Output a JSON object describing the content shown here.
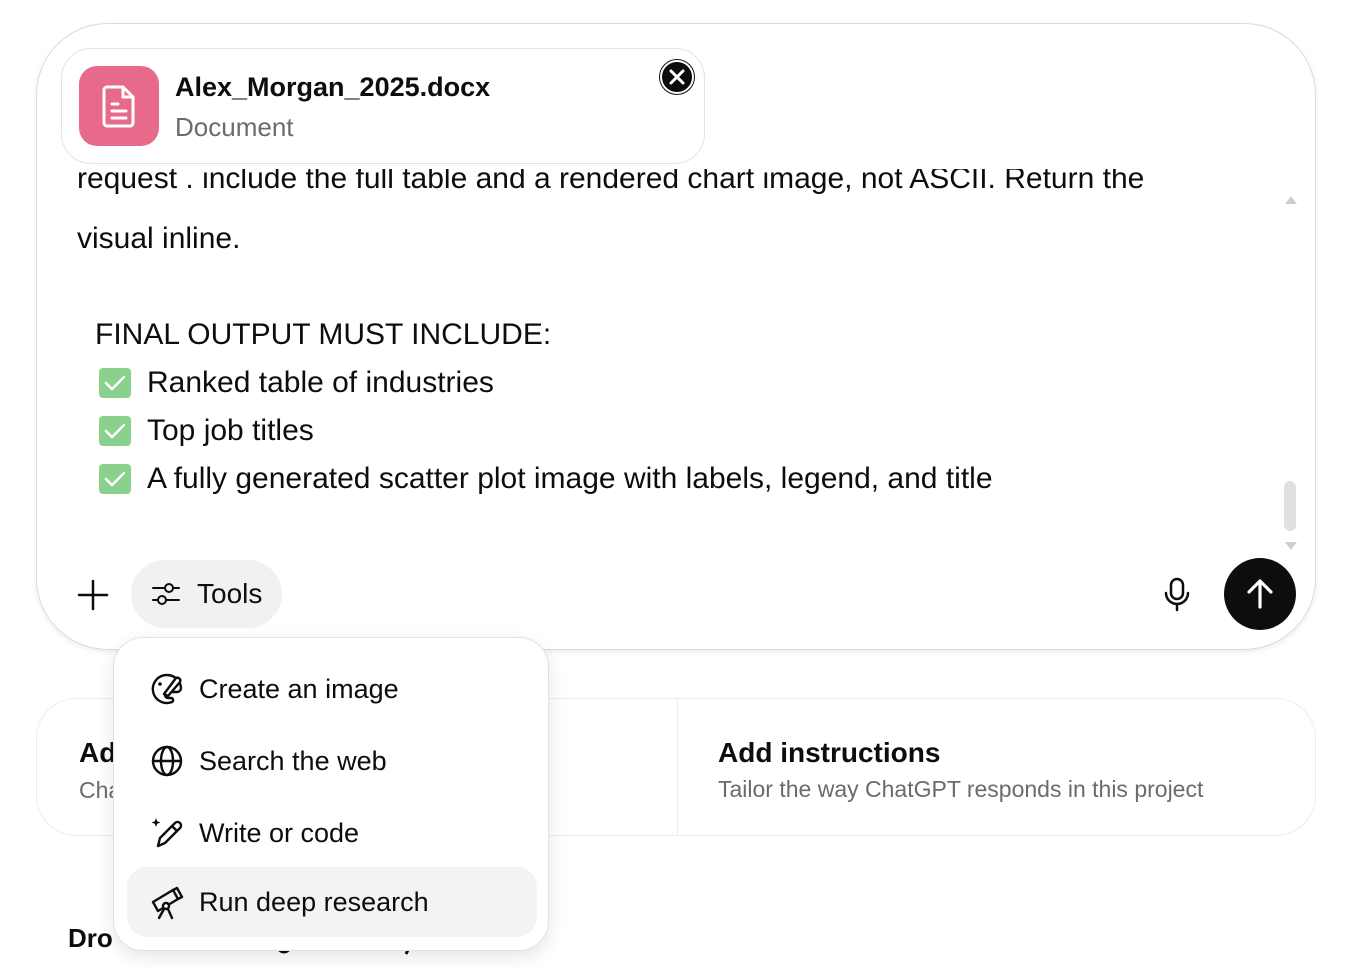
{
  "composer": {
    "attachment": {
      "file_name": "Alex_Morgan_2025.docx",
      "file_type": "Document"
    },
    "text": {
      "cut_line": "request . include the full table and a rendered chart image, not ASCII. Return the",
      "line2": "visual inline.",
      "final_heading": "FINAL OUTPUT MUST INCLUDE:",
      "checklist": [
        "Ranked table of industries",
        "Top job titles",
        "A fully generated scatter plot image with labels, legend, and title"
      ]
    },
    "tools_label": "Tools"
  },
  "tools_menu": {
    "items": [
      {
        "label": "Create an image",
        "icon": "image-brush-icon"
      },
      {
        "label": "Search the web",
        "icon": "globe-icon"
      },
      {
        "label": "Write or code",
        "icon": "pencil-sparkle-icon"
      },
      {
        "label": "Run deep research",
        "icon": "telescope-icon"
      }
    ]
  },
  "project_cards": {
    "left": {
      "title": "Ad",
      "subtitle": "Cha"
    },
    "right": {
      "title": "Add instructions",
      "subtitle": "Tailor the way ChatGPT responds in this project"
    }
  },
  "bottom": {
    "heading_fragment": "Dro"
  },
  "colors": {
    "file_icon_bg": "#e86a8b",
    "send_button_bg": "#0d0d0d",
    "checkbox_green": "#8ad18e",
    "active_menu_bg": "#f3f3f3"
  }
}
